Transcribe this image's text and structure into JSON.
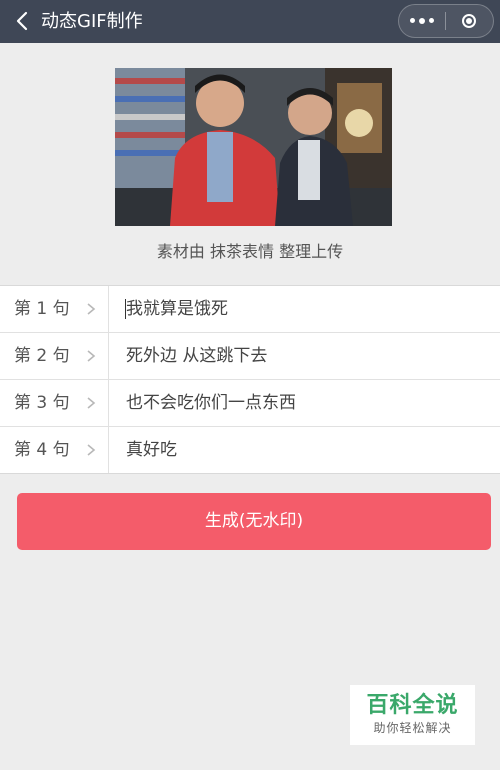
{
  "header": {
    "title": "动态GIF制作",
    "back_icon": "chevron-left-icon",
    "more_icon": "more-dots-icon",
    "close_icon": "target-close-icon"
  },
  "media": {
    "caption": "素材由 抹茶表情 整理上传"
  },
  "lines": [
    {
      "label": "第 1 句",
      "value": "我就算是饿死"
    },
    {
      "label": "第 2 句",
      "value": "死外边 从这跳下去"
    },
    {
      "label": "第 3 句",
      "value": "也不会吃你们一点东西"
    },
    {
      "label": "第 4 句",
      "value": "真好吃"
    }
  ],
  "generate_button": {
    "label": "生成(无水印)",
    "color": "#f45c6a"
  },
  "watermark": {
    "title": "百科全说",
    "subtitle": "助你轻松解决"
  },
  "colors": {
    "header_bg": "#3f4756",
    "page_bg": "#ededed",
    "brand_green": "#3aa86a"
  }
}
